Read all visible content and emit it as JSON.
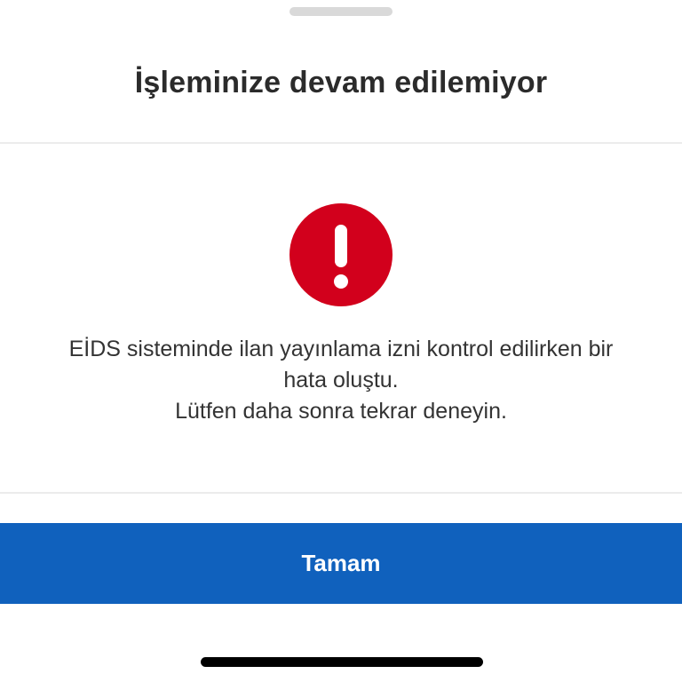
{
  "dialog": {
    "title": "İşleminize devam edilemiyor",
    "icon": "error-exclamation-icon",
    "message_lines": [
      "EİDS sisteminde ilan yayınlama izni kontrol edilirken bir",
      "hata oluştu.",
      "Lütfen daha sonra tekrar deneyin."
    ],
    "confirm_label": "Tamam"
  },
  "colors": {
    "accent": "#1061BD",
    "error": "#D2001C",
    "title_text": "#2B2B2B",
    "body_text": "#333333"
  }
}
